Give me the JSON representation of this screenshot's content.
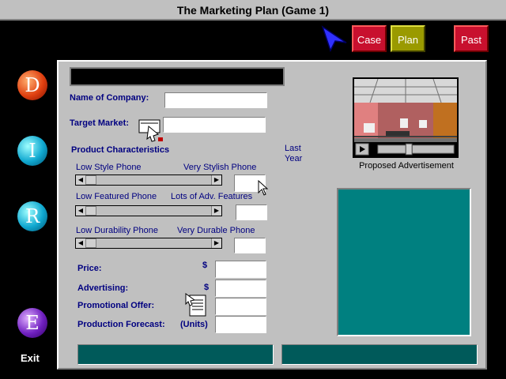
{
  "window": {
    "title": "The Marketing Plan (Game 1)"
  },
  "nav": {
    "case_label": "Case",
    "plan_label": "Plan",
    "past_label": "Past",
    "exit_label": "Exit",
    "spheres": [
      "D",
      "I",
      "R",
      "E"
    ]
  },
  "form": {
    "company_label": "Name of Company:",
    "target_label": "Target Market:",
    "product_heading": "Product Characteristics",
    "last_year_label": "Last\nYear",
    "style_low": "Low Style Phone",
    "style_high": "Very Stylish Phone",
    "feature_low": "Low Featured Phone",
    "feature_high": "Lots of Adv. Features",
    "durability_low": "Low Durability Phone",
    "durability_high": "Very Durable Phone",
    "price_label": "Price:",
    "advertising_label": "Advertising:",
    "promo_label": "Promotional Offer:",
    "forecast_label": "Production Forecast:",
    "currency_symbol": "$",
    "units_label": "(Units)"
  },
  "sliders": {
    "style": 0.0,
    "features": 0.0,
    "durability": 0.0
  },
  "media": {
    "caption": "Proposed Advertisement",
    "play_position": 0.4
  },
  "colors": {
    "panel": "#c0c0c0",
    "teal": "#008080",
    "case": "#c8102e",
    "plan": "#9a9a00"
  }
}
